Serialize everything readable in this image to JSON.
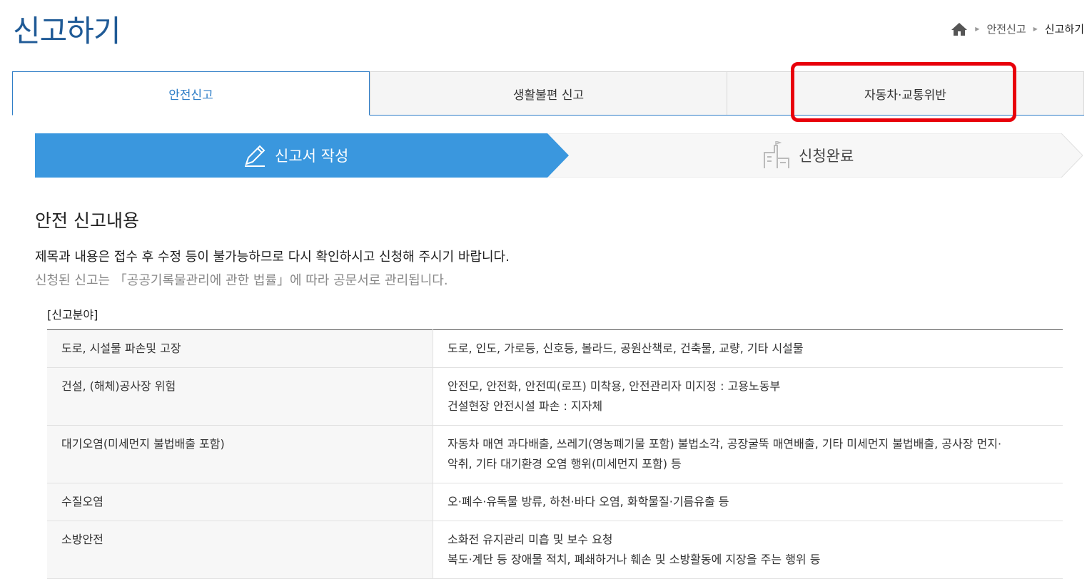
{
  "page": {
    "title": "신고하기",
    "breadcrumb": [
      "안전신고",
      "신고하기"
    ]
  },
  "tabs": [
    {
      "label": "안전신고",
      "active": true
    },
    {
      "label": "생활불편 신고",
      "active": false
    },
    {
      "label": "자동차·교통위반",
      "active": false
    }
  ],
  "steps": [
    {
      "label": "신고서 작성",
      "icon": "pencil-icon",
      "active": true
    },
    {
      "label": "신청완료",
      "icon": "building-icon",
      "active": false
    }
  ],
  "section": {
    "title": "안전 신고내용",
    "notice_main": "제목과 내용은 접수 후 수정 등이 불가능하므로 다시 확인하시고 신청해 주시기 바랍니다.",
    "notice_sub": "신청된 신고는 「공공기록물관리에 관한 법률」에 따라 공문서로 관리됩니다."
  },
  "fields_table": {
    "caption": "[신고분야]",
    "rows": [
      {
        "category": "도로, 시설물 파손및 고장",
        "description": [
          "도로, 인도, 가로등, 신호등, 볼라드, 공원산책로, 건축물, 교량, 기타 시설물"
        ]
      },
      {
        "category": "건설, (해체)공사장 위험",
        "description": [
          "안전모, 안전화, 안전띠(로프) 미착용, 안전관리자 미지정 : 고용노동부",
          "건설현장 안전시설 파손 : 지자체"
        ]
      },
      {
        "category": "대기오염(미세먼지 불법배출 포함)",
        "description": [
          "자동차 매연 과다배출, 쓰레기(영농폐기물 포함) 불법소각, 공장굴뚝 매연배출, 기타 미세먼지 불법배출, 공사장 먼지·",
          "악취, 기타 대기환경 오염 행위(미세먼지 포함) 등"
        ]
      },
      {
        "category": "수질오염",
        "description": [
          "오·폐수·유독물 방류, 하천·바다 오염, 화학물질·기름유출 등"
        ]
      },
      {
        "category": "소방안전",
        "description": [
          "소화전 유지관리 미흡 및 보수 요청",
          "복도·계단 등 장애물 적치, 폐쇄하거나 훼손 및 소방활동에 지장을 주는 행위 등"
        ]
      }
    ]
  },
  "colors": {
    "accent": "#2f7ec7",
    "step_active": "#3a97de",
    "highlight": "#e8000b",
    "title": "#1f5a96"
  }
}
